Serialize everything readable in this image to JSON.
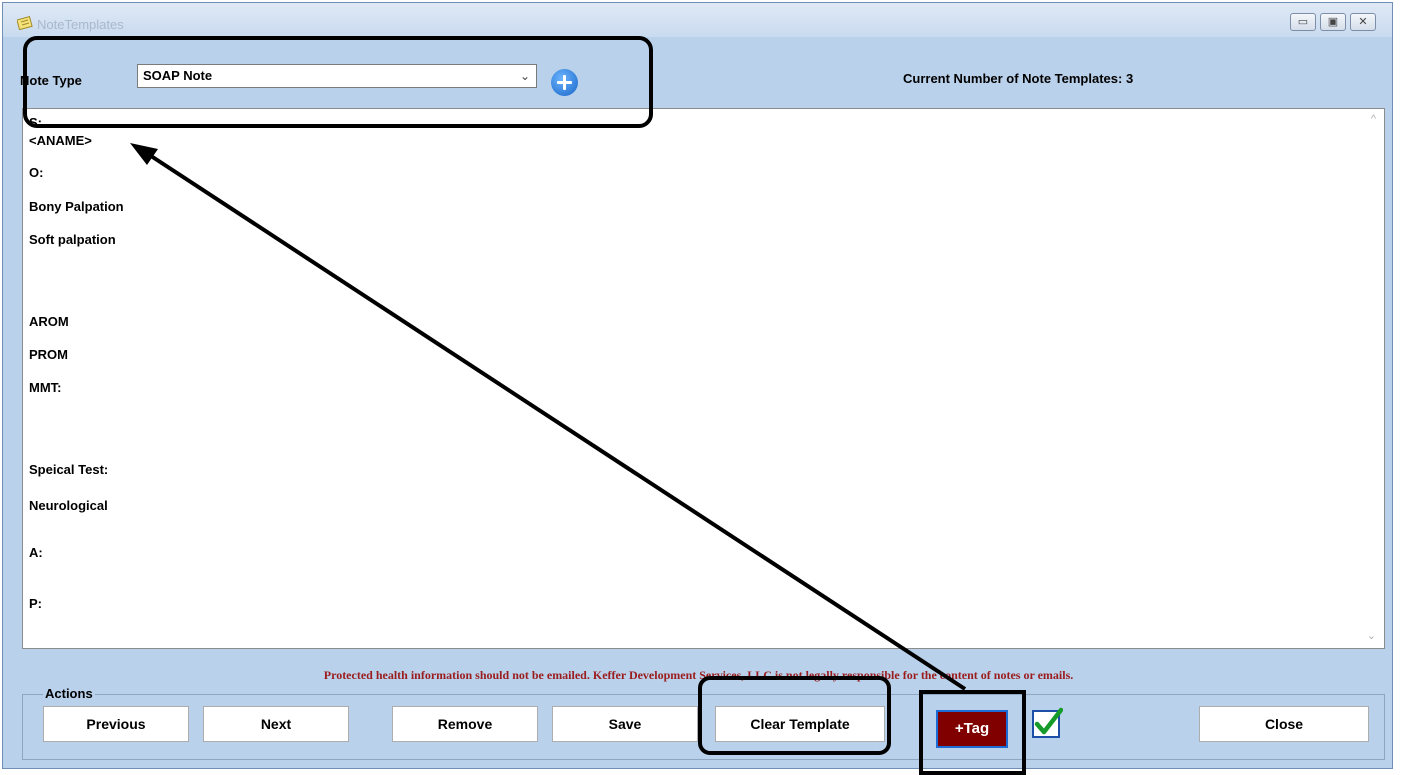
{
  "window": {
    "title": "NoteTemplates",
    "minimize_label": "▭",
    "maximize_label": "▣",
    "close_label": "✕"
  },
  "note_type": {
    "label": "Note Type",
    "selected": "SOAP Note",
    "arrow": "⌄"
  },
  "template_count_text": "Current Number of Note Templates: 3",
  "template_lines": [
    "S:",
    "<ANAME>",
    "O:",
    "Bony Palpation",
    "Soft palpation",
    "AROM",
    "PROM",
    "MMT:",
    "Speical Test:",
    "Neurological",
    "A:",
    "P:"
  ],
  "scrollbar": {
    "up": "^",
    "down": "⌄"
  },
  "disclaimer": "Protected health information should not be emailed.  Keffer Development Services, LLC is not legally responsible for the content of notes or emails.",
  "actions": {
    "group_title": "Actions",
    "previous": "Previous",
    "next": "Next",
    "remove": "Remove",
    "save": "Save",
    "clear_template": "Clear Template",
    "tag": "+Tag",
    "close": "Close"
  },
  "colors": {
    "background": "#b9d1ea",
    "tag_button": "#800000",
    "disclaimer": "#9b1c1c"
  }
}
